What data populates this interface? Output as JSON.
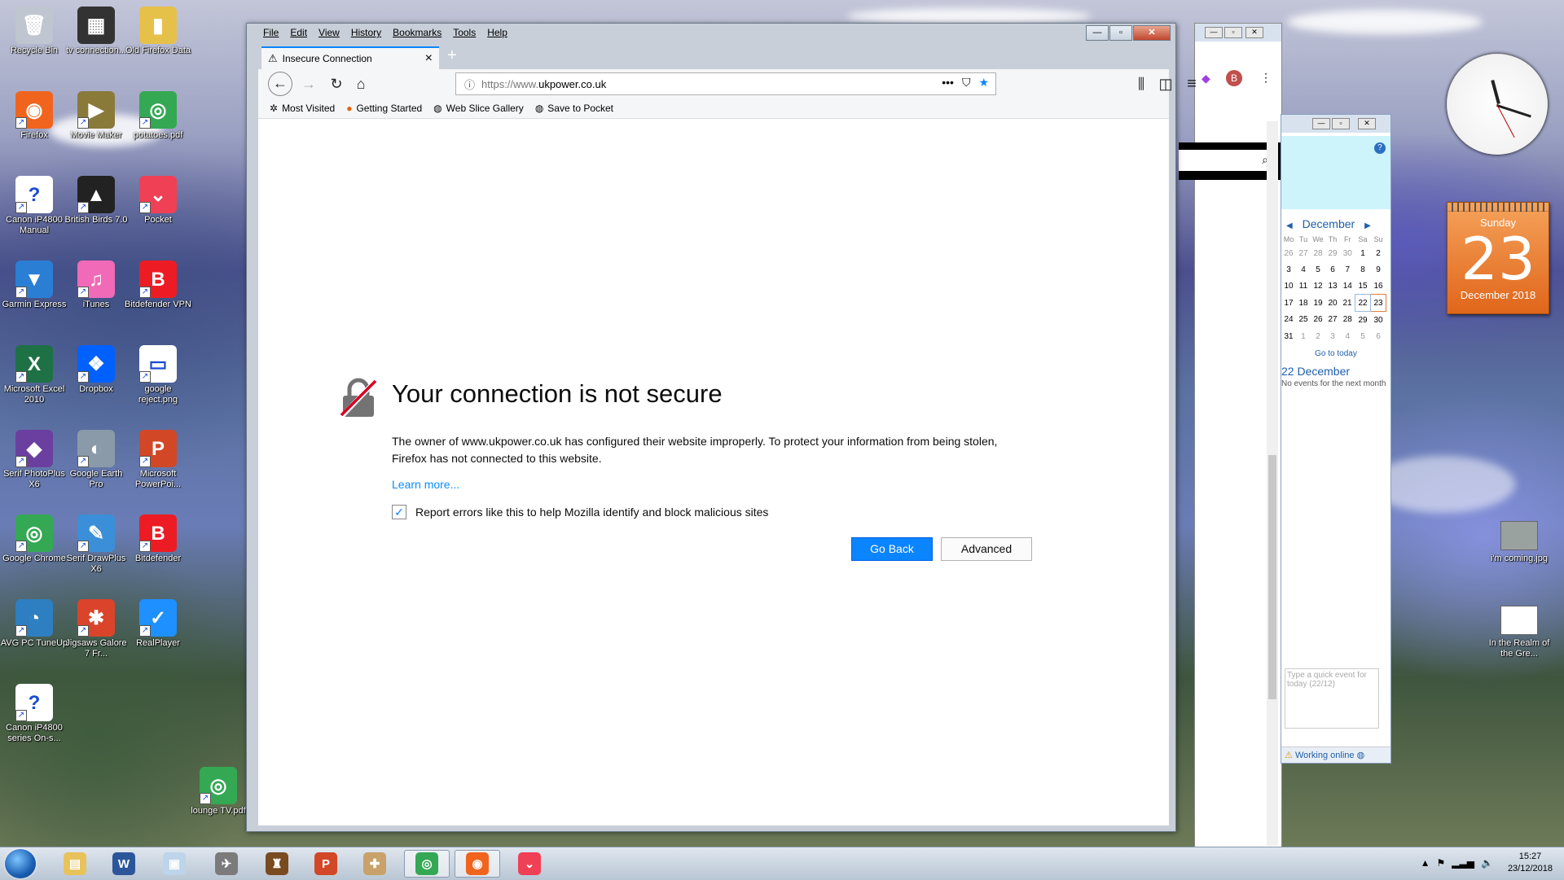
{
  "desktop_icons": [
    {
      "label": "Recycle Bin",
      "icon": "recycle-bin-icon",
      "color": "#bfc6cf",
      "glyph": "🗑"
    },
    {
      "label": "tv connection...",
      "icon": "tv-icon",
      "color": "#333333",
      "glyph": "▦"
    },
    {
      "label": "Old Firefox Data",
      "icon": "folder-icon",
      "color": "#e6c14a",
      "glyph": "▮"
    },
    {
      "label": "Firefox",
      "icon": "firefox-icon",
      "color": "#f0641e",
      "glyph": "◉"
    },
    {
      "label": "Movie Maker",
      "icon": "movie-maker-icon",
      "color": "#8a7a3a",
      "glyph": "▶"
    },
    {
      "label": "potatoes.pdf",
      "icon": "chrome-icon",
      "color": "#34a853",
      "glyph": "◎"
    },
    {
      "label": "Canon iP4800 Manual",
      "icon": "manual-icon",
      "color": "#ffffff",
      "glyph": "?"
    },
    {
      "label": "British Birds 7.0",
      "icon": "bird-icon",
      "color": "#222222",
      "glyph": "▲"
    },
    {
      "label": "Pocket",
      "icon": "pocket-icon",
      "color": "#ef4056",
      "glyph": "⌄"
    },
    {
      "label": "Garmin Express",
      "icon": "garmin-icon",
      "color": "#2a7fd4",
      "glyph": "▼"
    },
    {
      "label": "iTunes",
      "icon": "itunes-icon",
      "color": "#f06ab8",
      "glyph": "♫"
    },
    {
      "label": "Bitdefender VPN",
      "icon": "bitdefender-vpn-icon",
      "color": "#ed1c24",
      "glyph": "B"
    },
    {
      "label": "Microsoft Excel 2010",
      "icon": "excel-icon",
      "color": "#1e7145",
      "glyph": "X"
    },
    {
      "label": "Dropbox",
      "icon": "dropbox-icon",
      "color": "#0061fe",
      "glyph": "❖"
    },
    {
      "label": "google reject.png",
      "icon": "image-file-icon",
      "color": "#ffffff",
      "glyph": "▭"
    },
    {
      "label": "Serif PhotoPlus X6",
      "icon": "photoplus-icon",
      "color": "#6b3fa0",
      "glyph": "◆"
    },
    {
      "label": "Google Earth Pro",
      "icon": "google-earth-icon",
      "color": "#8a9aa8",
      "glyph": "◐"
    },
    {
      "label": "Microsoft PowerPoi...",
      "icon": "powerpoint-icon",
      "color": "#d24726",
      "glyph": "P"
    },
    {
      "label": "Google Chrome",
      "icon": "chrome-icon",
      "color": "#34a853",
      "glyph": "◎"
    },
    {
      "label": "Serif DrawPlus X6",
      "icon": "drawplus-icon",
      "color": "#3a8fd8",
      "glyph": "✎"
    },
    {
      "label": "Bitdefender",
      "icon": "bitdefender-icon",
      "color": "#ed1c24",
      "glyph": "B"
    },
    {
      "label": "AVG PC TuneUp",
      "icon": "avg-icon",
      "color": "#2d7fc1",
      "glyph": "◔"
    },
    {
      "label": "Jigsaws Galore 7 Fr...",
      "icon": "jigsaw-icon",
      "color": "#d9442b",
      "glyph": "✱"
    },
    {
      "label": "RealPlayer",
      "icon": "realplayer-icon",
      "color": "#1e90ff",
      "glyph": "✓"
    },
    {
      "label": "Canon iP4800 series On-s...",
      "icon": "manual-icon",
      "color": "#ffffff",
      "glyph": "?"
    },
    {
      "label": "lounge TV.pdf",
      "icon": "chrome-icon",
      "color": "#34a853",
      "glyph": "◎"
    }
  ],
  "desktop_files_right": [
    {
      "label": "i'm coming.jpg",
      "icon": "image-file-icon"
    },
    {
      "label": "In the Realm of the Gre...",
      "icon": "video-file-icon"
    }
  ],
  "gadgets": {
    "calendar": {
      "weekday": "Sunday",
      "day": "23",
      "month_year": "December 2018"
    }
  },
  "firefox": {
    "menu": [
      "File",
      "Edit",
      "View",
      "History",
      "Bookmarks",
      "Tools",
      "Help"
    ],
    "tab_title": "Insecure Connection",
    "url_protocol": "https://www.",
    "url_host": "ukpower.co.uk",
    "bookmarks": [
      {
        "label": "Most Visited",
        "icon": "gear-icon",
        "glyph": "✲"
      },
      {
        "label": "Getting Started",
        "icon": "firefox-small-icon",
        "glyph": "●"
      },
      {
        "label": "Web Slice Gallery",
        "icon": "web-slice-icon",
        "glyph": "◍"
      },
      {
        "label": "Save to Pocket",
        "icon": "pocket-globe-icon",
        "glyph": "◍"
      }
    ],
    "error": {
      "title": "Your connection is not secure",
      "description": "The owner of www.ukpower.co.uk has configured their website improperly. To protect your information from being stolen, Firefox has not connected to this website.",
      "learn_more": "Learn more...",
      "report_label": "Report errors like this to help Mozilla identify and block malicious sites",
      "report_checked": true,
      "go_back": "Go Back",
      "advanced": "Advanced"
    },
    "accent": "#0a84ff"
  },
  "outlook": {
    "month": "December",
    "weekdays": [
      "Mo",
      "Tu",
      "We",
      "Th",
      "Fr",
      "Sa",
      "Su"
    ],
    "weeks": [
      [
        "26",
        "27",
        "28",
        "29",
        "30",
        "1",
        "2"
      ],
      [
        "3",
        "4",
        "5",
        "6",
        "7",
        "8",
        "9"
      ],
      [
        "10",
        "11",
        "12",
        "13",
        "14",
        "15",
        "16"
      ],
      [
        "17",
        "18",
        "19",
        "20",
        "21",
        "22",
        "23"
      ],
      [
        "24",
        "25",
        "26",
        "27",
        "28",
        "29",
        "30"
      ],
      [
        "31",
        "1",
        "2",
        "3",
        "4",
        "5",
        "6"
      ]
    ],
    "go_to_today": "Go to today",
    "selected_date": "22 December",
    "no_events": "No events for the next month",
    "quick_event_placeholder": "Type a quick event for today (22/12)",
    "status": "Working online"
  },
  "taskbar": {
    "items": [
      {
        "icon": "explorer-icon",
        "color": "#e8c25a",
        "glyph": "▤"
      },
      {
        "icon": "word-icon",
        "color": "#2b579a",
        "glyph": "W"
      },
      {
        "icon": "image-viewer-icon",
        "color": "#bdd4ea",
        "glyph": "▣"
      },
      {
        "icon": "airplane-icon",
        "color": "#7b7b7b",
        "glyph": "✈"
      },
      {
        "icon": "game-icon",
        "color": "#7a4a20",
        "glyph": "♜"
      },
      {
        "icon": "powerpoint-icon",
        "color": "#d24726",
        "glyph": "P"
      },
      {
        "icon": "map-icon",
        "color": "#c8a26a",
        "glyph": "✚"
      },
      {
        "icon": "chrome-icon",
        "color": "#34a853",
        "glyph": "◎"
      },
      {
        "icon": "firefox-icon",
        "color": "#f0641e",
        "glyph": "◉"
      },
      {
        "icon": "pocket-icon",
        "color": "#ef4056",
        "glyph": "⌄"
      }
    ],
    "time": "15:27",
    "date": "23/12/2018"
  }
}
